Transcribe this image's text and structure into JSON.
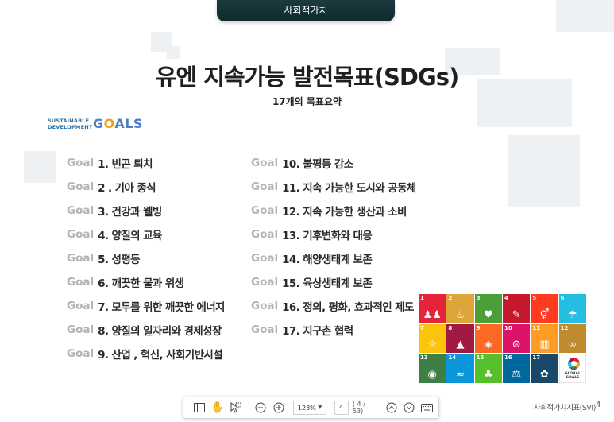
{
  "header": {
    "tab_label": "사회적가치"
  },
  "slide": {
    "title": "유엔 지속가능 발전목표(SDGs)",
    "subtitle": "17개의 목표요약",
    "logo": {
      "line1": "SUSTAINABLE",
      "line2": "DEVELOPMENT",
      "goals_pre": "G",
      "goals_o": "O",
      "goals_post": "ALS"
    },
    "goal_prefix": "Goal",
    "goals_left": [
      "1. 빈곤 퇴치",
      "2 . 기아 종식",
      "3. 건강과 웰빙",
      "4. 양질의 교육",
      "5. 성평등",
      "6. 깨끗한 물과 위생",
      "7. 모두를 위한 깨끗한 에너지",
      "8. 양질의 일자리와 경제성장",
      "9. 산업 , 혁신, 사회기반시설"
    ],
    "goals_right": [
      "10. 불평등 감소",
      "11. 지속 가능한 도시와 공동체",
      "12. 지속 가능한 생산과 소비",
      "13. 기후변화와 대응",
      "14. 해양생태계 보존",
      "15. 육상생태계 보존",
      "16. 정의, 평화, 효과적인 제도",
      "17. 지구촌 협력"
    ]
  },
  "sdg_tiles": [
    {
      "num": "1",
      "color": "#e5243b",
      "icon": "family-icon",
      "glyph": "♟♟"
    },
    {
      "num": "2",
      "color": "#dda63a",
      "icon": "bowl-icon",
      "glyph": "♨"
    },
    {
      "num": "3",
      "color": "#4c9f38",
      "icon": "heartbeat-icon",
      "glyph": "♥"
    },
    {
      "num": "4",
      "color": "#c5192d",
      "icon": "book-icon",
      "glyph": "✎"
    },
    {
      "num": "5",
      "color": "#ff3a21",
      "icon": "gender-icon",
      "glyph": "⚥"
    },
    {
      "num": "6",
      "color": "#26bde2",
      "icon": "water-icon",
      "glyph": "☂"
    },
    {
      "num": "7",
      "color": "#fcc30b",
      "icon": "sun-icon",
      "glyph": "☼"
    },
    {
      "num": "8",
      "color": "#a21942",
      "icon": "growth-chart-icon",
      "glyph": "▲"
    },
    {
      "num": "9",
      "color": "#fd6925",
      "icon": "cubes-icon",
      "glyph": "◈"
    },
    {
      "num": "10",
      "color": "#dd1367",
      "icon": "equal-icon",
      "glyph": "⊜"
    },
    {
      "num": "11",
      "color": "#fd9d24",
      "icon": "city-icon",
      "glyph": "▥"
    },
    {
      "num": "12",
      "color": "#bf8b2e",
      "icon": "infinity-icon",
      "glyph": "∞"
    },
    {
      "num": "13",
      "color": "#3f7e44",
      "icon": "eye-earth-icon",
      "glyph": "◉"
    },
    {
      "num": "14",
      "color": "#0a97d9",
      "icon": "fish-icon",
      "glyph": "≈"
    },
    {
      "num": "15",
      "color": "#56c02b",
      "icon": "tree-icon",
      "glyph": "♣"
    },
    {
      "num": "16",
      "color": "#00689d",
      "icon": "dove-icon",
      "glyph": "⚖"
    },
    {
      "num": "17",
      "color": "#19486a",
      "icon": "flower-icon",
      "glyph": "✿"
    }
  ],
  "global_goals_label": "THE GLOBAL GOALS",
  "toolbar": {
    "zoom_value": "123%",
    "page_value": "4",
    "page_count": "( 4 / 53)"
  },
  "footer": {
    "label": "사회적가치지표(SVI)",
    "page_number": "4"
  }
}
